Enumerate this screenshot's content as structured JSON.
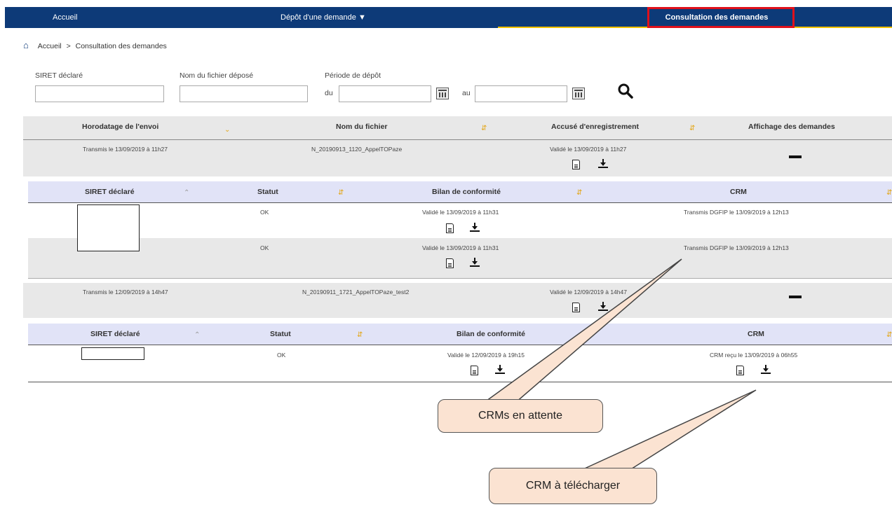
{
  "nav": {
    "accueil": "Accueil",
    "depot": "Dépôt d'une demande ▼",
    "consultation": "Consultation des demandes"
  },
  "breadcrumb": {
    "home": "Accueil",
    "sep": ">",
    "current": "Consultation des demandes"
  },
  "filters": {
    "siret_label": "SIRET déclaré",
    "siret_value": "",
    "fichier_label": "Nom du fichier déposé",
    "fichier_value": "",
    "periode_label": "Période de dépôt",
    "du": "du",
    "au": "au"
  },
  "main_table": {
    "headers": [
      "Horodatage de l'envoi",
      "Nom du fichier",
      "Accusé d'enregistrement",
      "Affichage des demandes"
    ]
  },
  "sub_table": {
    "headers": [
      "SIRET déclaré",
      "Statut",
      "Bilan de conformité",
      "CRM"
    ]
  },
  "envois": [
    {
      "horodatage": "Transmis le 13/09/2019 à 11h27",
      "fichier": "N_20190913_1120_AppelTOPaze",
      "accuse": "Validé le 13/09/2019 à 11h27",
      "demandes": [
        {
          "statut": "OK",
          "bilan": "Validé le 13/09/2019 à 11h31",
          "crm": "Transmis DGFIP le 13/09/2019 à 12h13"
        },
        {
          "statut": "OK",
          "bilan": "Validé le 13/09/2019 à 11h31",
          "crm": "Transmis DGFIP le 13/09/2019 à 12h13"
        }
      ]
    },
    {
      "horodatage": "Transmis le 12/09/2019 à 14h47",
      "fichier": "N_20190911_1721_AppelTOPaze_test2",
      "accuse": "Validé le 12/09/2019 à 14h47",
      "demandes": [
        {
          "statut": "OK",
          "bilan": "Validé le 12/09/2019 à 19h15",
          "crm": "CRM reçu le 13/09/2019 à 06h55"
        }
      ]
    }
  ],
  "callouts": {
    "attente": "CRMs en attente",
    "telecharger": "CRM à télécharger"
  },
  "colors": {
    "nav": "#0d3a78",
    "highlight": "#e0111b",
    "accent": "#f2c200",
    "band": "#e8e8e8",
    "subband": "#e1e3f7"
  }
}
